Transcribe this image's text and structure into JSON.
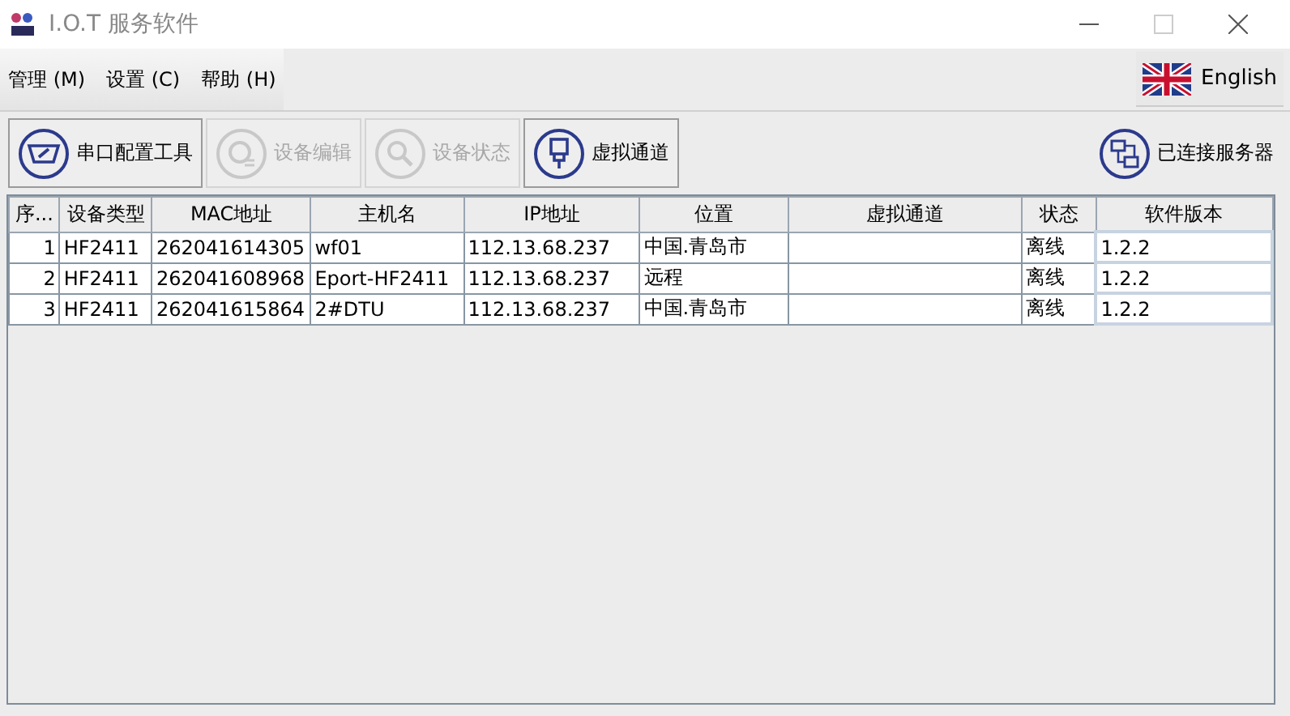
{
  "window": {
    "title": "I.O.T 服务软件"
  },
  "menu": [
    "管理 (M)",
    "设置 (C)",
    "帮助 (H)"
  ],
  "language": {
    "label": "English"
  },
  "toolbar": [
    {
      "label": "串口配置工具",
      "disabled": false
    },
    {
      "label": "设备编辑",
      "disabled": true
    },
    {
      "label": "设备状态",
      "disabled": true
    },
    {
      "label": "虚拟通道",
      "disabled": false
    }
  ],
  "server_status": {
    "label": "已连接服务器"
  },
  "table": {
    "columns": [
      "序...",
      "设备类型",
      "MAC地址",
      "主机名",
      "IP地址",
      "位置",
      "虚拟通道",
      "状态",
      "软件版本"
    ],
    "rows": [
      [
        "1",
        "HF2411",
        "262041614305",
        "wf01",
        "112.13.68.237",
        "中国.青岛市",
        "",
        "离线",
        "1.2.2"
      ],
      [
        "2",
        "HF2411",
        "262041608968",
        "Eport-HF2411",
        "112.13.68.237",
        "远程",
        "",
        "离线",
        "1.2.2"
      ],
      [
        "3",
        "HF2411",
        "262041615864",
        "2#DTU",
        "112.13.68.237",
        "中国.青岛市",
        "",
        "离线",
        "1.2.2"
      ]
    ]
  }
}
